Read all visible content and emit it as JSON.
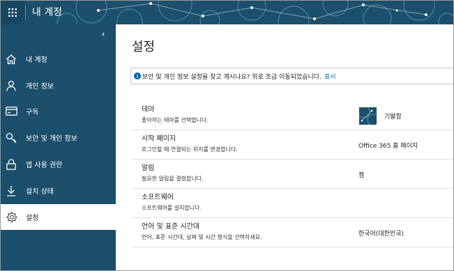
{
  "header": {
    "app_title": "내 계정",
    "waffle_icon": "app-launcher-icon",
    "bar_color": "#1b4f6b"
  },
  "sidebar": {
    "collapse_glyph": "‹",
    "items": [
      {
        "label": "내 계정",
        "icon": "home-icon"
      },
      {
        "label": "개인 정보",
        "icon": "person-icon"
      },
      {
        "label": "구독",
        "icon": "credit-card-icon"
      },
      {
        "label": "보안 및 개인 정보",
        "icon": "key-icon"
      },
      {
        "label": "앱 사용 권한",
        "icon": "lock-icon"
      },
      {
        "label": "설치 상태",
        "icon": "download-icon"
      },
      {
        "label": "설정",
        "icon": "gear-icon",
        "active": true
      }
    ]
  },
  "main": {
    "title": "설정",
    "info": {
      "text": "보안 및 개인 정보 설정을 찾고 계시나요? 위로 조금 이동되었습니다.",
      "link": "표시"
    },
    "rows": [
      {
        "name": "테마",
        "desc": "좋아하는 테마를 선택합니다.",
        "value": "기발함"
      },
      {
        "name": "시작 페이지",
        "desc": "로그인할 때 연결되는 위치를 변경합니다.",
        "value": "Office 365 홈 페이지"
      },
      {
        "name": "알림",
        "desc": "필요한 알림을 결정합니다.",
        "value": "켬"
      },
      {
        "name": "소프트웨어",
        "desc": "소프트웨어를 설치합니다.",
        "value": ""
      },
      {
        "name": "언어 및 표준 시간대",
        "desc": "언어, 표준 시간대, 날짜 및 시간 형식을 선택하세요.",
        "value": "한국어(대한민국)"
      }
    ]
  },
  "colors": {
    "accent": "#1b4f6b",
    "link": "#0062ad"
  }
}
